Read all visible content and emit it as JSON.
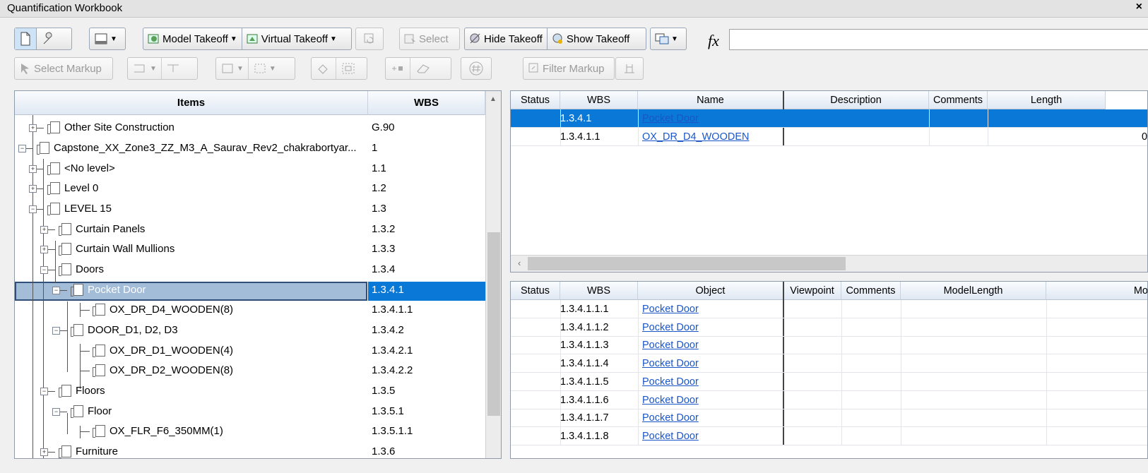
{
  "window": {
    "title": "Quantification Workbook",
    "close": "×"
  },
  "toolbar": {
    "model_takeoff": "Model Takeoff",
    "virtual_takeoff": "Virtual Takeoff",
    "select": "Select",
    "hide_takeoff": "Hide Takeoff",
    "show_takeoff": "Show Takeoff",
    "select_markup": "Select Markup",
    "filter_markup": "Filter Markup",
    "fx": "fx"
  },
  "tree": {
    "col_items": "Items",
    "col_wbs": "WBS",
    "rows": [
      {
        "label": "Other Site Construction",
        "wbs": "G.90"
      },
      {
        "label": "Capstone_XX_Zone3_ZZ_M3_A_Saurav_Rev2_chakrabortyar...",
        "wbs": "1"
      },
      {
        "label": "<No level>",
        "wbs": "1.1"
      },
      {
        "label": "Level 0",
        "wbs": "1.2"
      },
      {
        "label": "LEVEL 15",
        "wbs": "1.3"
      },
      {
        "label": "Curtain Panels",
        "wbs": "1.3.2"
      },
      {
        "label": "Curtain Wall Mullions",
        "wbs": "1.3.3"
      },
      {
        "label": "Doors",
        "wbs": "1.3.4"
      },
      {
        "label": "Pocket Door",
        "wbs": "1.3.4.1"
      },
      {
        "label": "OX_DR_D4_WOODEN(8)",
        "wbs": "1.3.4.1.1"
      },
      {
        "label": "DOOR_D1, D2, D3",
        "wbs": "1.3.4.2"
      },
      {
        "label": "OX_DR_D1_WOODEN(4)",
        "wbs": "1.3.4.2.1"
      },
      {
        "label": "OX_DR_D2_WOODEN(8)",
        "wbs": "1.3.4.2.2"
      },
      {
        "label": "Floors",
        "wbs": "1.3.5"
      },
      {
        "label": "Floor",
        "wbs": "1.3.5.1"
      },
      {
        "label": "OX_FLR_F6_350MM(1)",
        "wbs": "1.3.5.1.1"
      },
      {
        "label": "Furniture",
        "wbs": "1.3.6"
      }
    ]
  },
  "top_grid": {
    "headers": [
      "Status",
      "WBS",
      "Name",
      "Description",
      "Comments",
      "Length"
    ],
    "rows": [
      {
        "wbs": "1.3.4.1",
        "name": "Pocket Door",
        "length": ""
      },
      {
        "wbs": "1.3.4.1.1",
        "name": "OX_DR_D4_WOODEN",
        "length": "0"
      }
    ]
  },
  "bottom_grid": {
    "headers": [
      "Status",
      "WBS",
      "Object",
      "Viewpoint",
      "Comments",
      "ModelLength",
      "Mo"
    ],
    "rows": [
      {
        "wbs": "1.3.4.1.1.1",
        "object": "Pocket Door"
      },
      {
        "wbs": "1.3.4.1.1.2",
        "object": "Pocket Door"
      },
      {
        "wbs": "1.3.4.1.1.3",
        "object": "Pocket Door"
      },
      {
        "wbs": "1.3.4.1.1.4",
        "object": "Pocket Door"
      },
      {
        "wbs": "1.3.4.1.1.5",
        "object": "Pocket Door"
      },
      {
        "wbs": "1.3.4.1.1.6",
        "object": "Pocket Door"
      },
      {
        "wbs": "1.3.4.1.1.7",
        "object": "Pocket Door"
      },
      {
        "wbs": "1.3.4.1.1.8",
        "object": "Pocket Door"
      }
    ]
  },
  "colors": {
    "selection": "#0a78d7",
    "tree_selection": "#a3bcd8",
    "link": "#1a56c8"
  }
}
